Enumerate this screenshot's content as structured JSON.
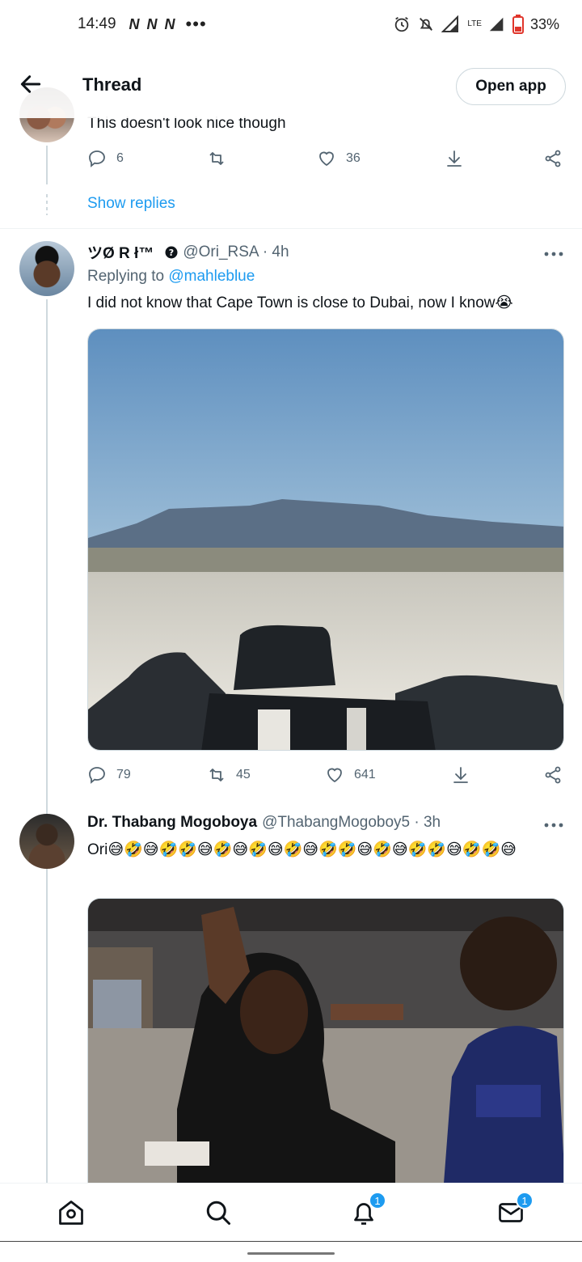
{
  "status_bar": {
    "time": "14:49",
    "notif_icons": [
      "N",
      "N",
      "N"
    ],
    "more": "•••",
    "battery": "33%",
    "network": "LTE"
  },
  "header": {
    "title": "Thread",
    "open_app": "Open app"
  },
  "tweet1": {
    "text": "This doesn't look nice though",
    "replies": "6",
    "retweets": "",
    "likes": "36",
    "show_replies": "Show replies"
  },
  "tweet2": {
    "name": "ツØ R ł™",
    "handle": "@Ori_RSA · 4h",
    "replying_prefix": "Replying to",
    "replying_to": "@mahleblue",
    "text": "I did not know that Cape Town is close to Dubai, now I know😭",
    "replies": "79",
    "retweets": "45",
    "likes": "641"
  },
  "tweet3": {
    "name": "Dr. Thabang Mogoboya",
    "handle": "@ThabangMogoboy5 · 3h",
    "text": "Ori😅🤣😅🤣🤣😅🤣😅🤣😅🤣😅🤣🤣😅🤣😅🤣🤣😅🤣🤣😅"
  },
  "bottom_nav": {
    "notifications_badge": "1",
    "messages_badge": "1"
  },
  "colors": {
    "accent": "#1d9bf0",
    "text": "#0f1419",
    "muted": "#536471",
    "border": "#cfd9de"
  }
}
